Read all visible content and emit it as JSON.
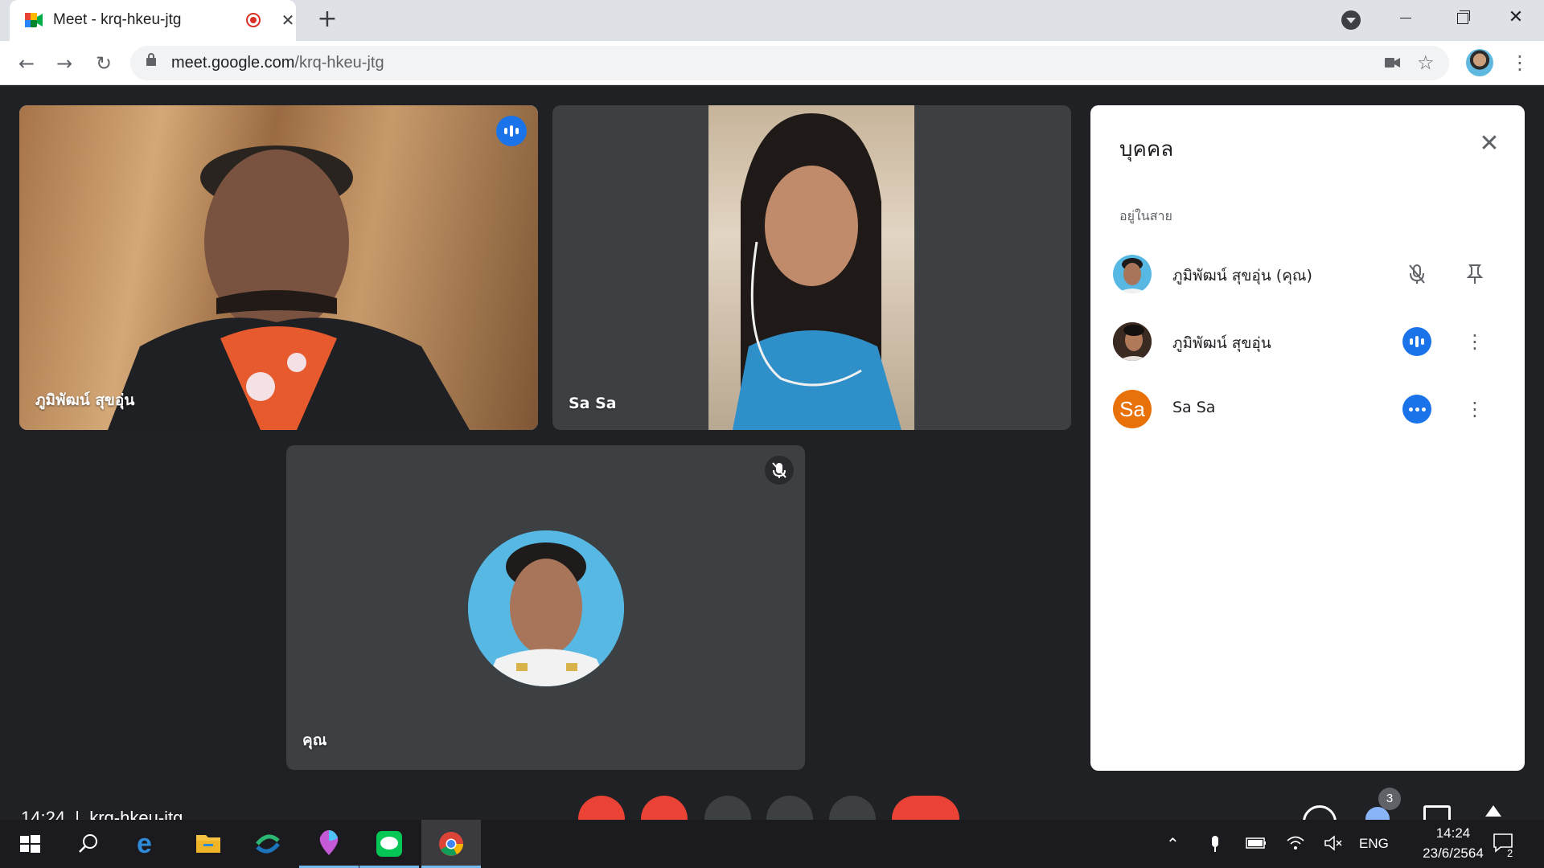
{
  "browser": {
    "tab_title": "Meet - krq-hkeu-jtg",
    "new_tab_symbol": "+",
    "url_host": "meet.google.com",
    "url_path": "/krq-hkeu-jtg",
    "window_min": "",
    "window_max": "",
    "window_close": "✕"
  },
  "tiles": [
    {
      "name": "ภูมิพัฒน์ สุขอุ่น",
      "state": "speaking"
    },
    {
      "name": "Sa Sa",
      "state": "video"
    },
    {
      "name": "คุณ",
      "state": "muted"
    }
  ],
  "panel": {
    "title": "บุคคล",
    "section": "อยู่ในสาย",
    "people": [
      {
        "name": "ภูมิพัฒน์ สุขอุ่น (คุณ)",
        "status_icon": "mic-off-icon",
        "action_icon": "pin-icon"
      },
      {
        "name": "ภูมิพัฒน์ สุขอุ่น",
        "status_icon": "speaking-icon",
        "action_icon": "more-vert-icon"
      },
      {
        "name": "Sa Sa",
        "avatar_text": "Sa",
        "status_icon": "typing-dots-icon",
        "action_icon": "more-vert-icon"
      }
    ]
  },
  "meeting_bar": {
    "time": "14:24",
    "code": "krq-hkeu-jtg",
    "participants_badge": "3"
  },
  "taskbar": {
    "language": "ENG",
    "clock_time": "14:24",
    "clock_date": "23/6/2564",
    "notification_count": "2"
  },
  "colors": {
    "meet_bg": "#202124",
    "tile_bg": "#3c4043",
    "active_outline": "#8ab4f8",
    "speaking_blue": "#1a73e8",
    "end_call_red": "#ea4335",
    "sa_avatar_orange": "#e8710a"
  }
}
